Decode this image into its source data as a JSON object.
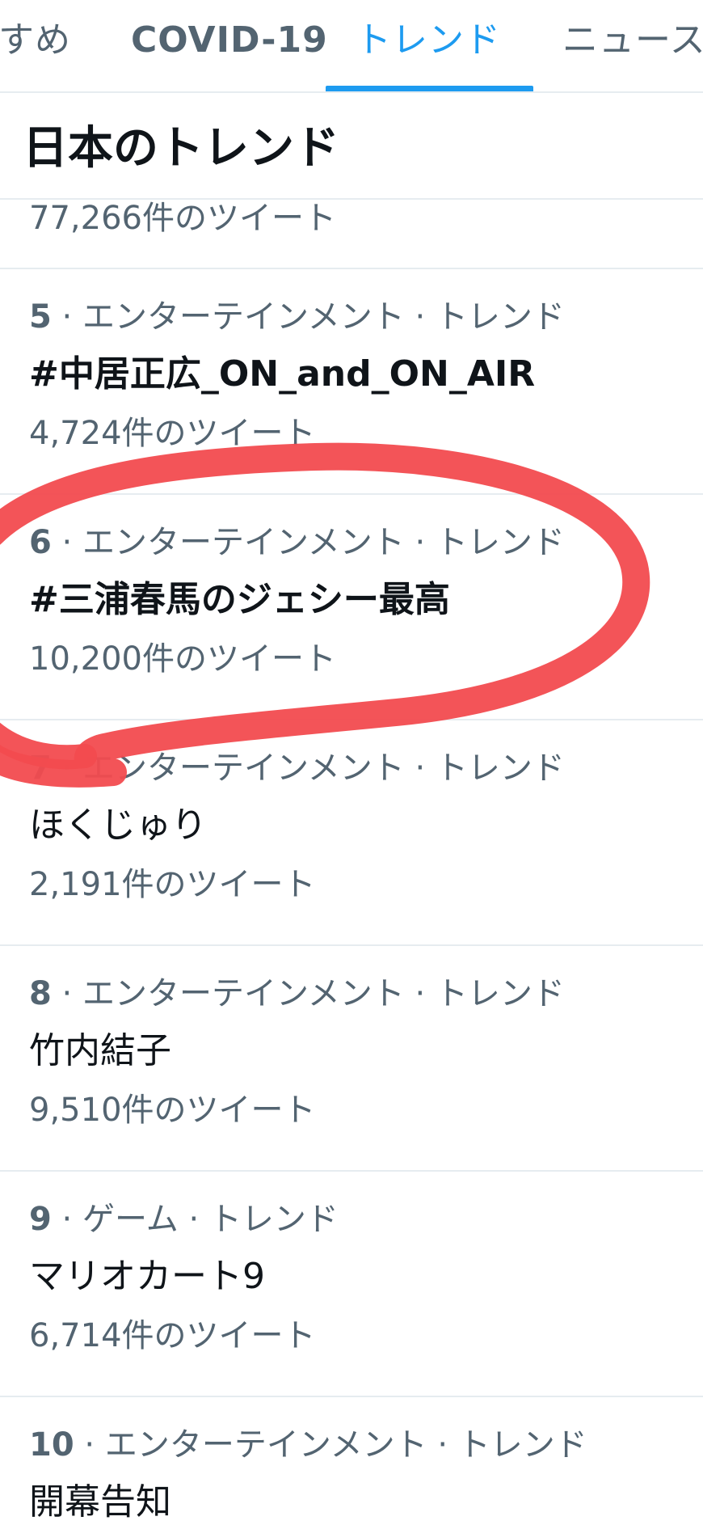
{
  "tabs": [
    {
      "label": "すめ",
      "active": false
    },
    {
      "label": "COVID-19",
      "active": false
    },
    {
      "label": "トレンド",
      "active": true
    },
    {
      "label": "ニュース",
      "active": false
    }
  ],
  "section": {
    "title": "日本のトレンド"
  },
  "partial_row": {
    "count": "77,266件のツイート"
  },
  "trends": [
    {
      "rank": "5",
      "meta": " · エンターテインメント · トレンド",
      "name": "#中居正広_ON_and_ON_AIR",
      "count": "4,724件のツイート"
    },
    {
      "rank": "6",
      "meta": " · エンターテインメント · トレンド",
      "name": "#三浦春馬のジェシー最高",
      "count": "10,200件のツイート"
    },
    {
      "rank": "7",
      "meta": " · エンターテインメント · トレンド",
      "name": "ほくじゅり",
      "count": "2,191件のツイート"
    },
    {
      "rank": "8",
      "meta": " · エンターテインメント · トレンド",
      "name": "竹内結子",
      "count": "9,510件のツイート"
    },
    {
      "rank": "9",
      "meta": " · ゲーム · トレンド",
      "name": "マリオカート9",
      "count": "6,714件のツイート"
    },
    {
      "rank": "10",
      "meta": " · エンターテインメント · トレンド",
      "name": "開幕告知",
      "count": ""
    }
  ],
  "colors": {
    "accent": "#1d9bf0",
    "secondary_text": "#536471",
    "primary_text": "#0f1419",
    "divider": "#e6ecf0",
    "highlight_mark": "#f24b4f"
  }
}
